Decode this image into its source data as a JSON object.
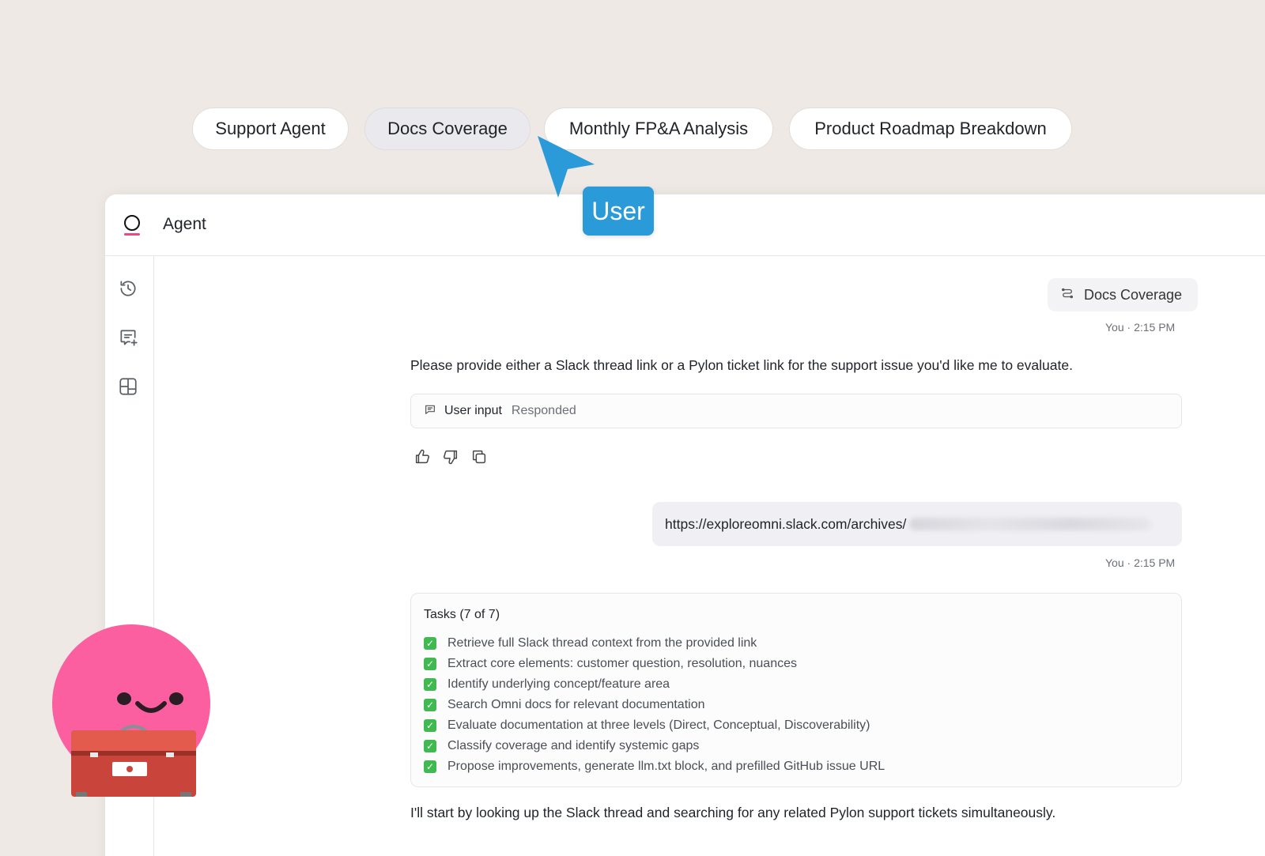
{
  "tabs": [
    {
      "label": "Support Agent",
      "active": false
    },
    {
      "label": "Docs Coverage",
      "active": true
    },
    {
      "label": "Monthly FP&A Analysis",
      "active": false
    },
    {
      "label": "Product Roadmap Breakdown",
      "active": false
    }
  ],
  "cursor_label": "User",
  "header": {
    "title": "Agent"
  },
  "sidebar": {
    "icons": [
      "history-icon",
      "new-chat-icon",
      "layout-icon"
    ]
  },
  "chat": {
    "workflow_chip": "Docs Coverage",
    "meta_1": "You · 2:15 PM",
    "agent_message_1": "Please provide either a Slack thread link or a Pylon ticket link for the support issue you'd like me to evaluate.",
    "user_input_label": "User input",
    "user_input_status": "Responded",
    "user_link": "https://exploreomni.slack.com/archives/",
    "meta_2": "You · 2:15 PM",
    "tasks_title": "Tasks (7 of 7)",
    "tasks": [
      "Retrieve full Slack thread context from the provided link",
      "Extract core elements: customer question, resolution, nuances",
      "Identify underlying concept/feature area",
      "Search Omni docs for relevant documentation",
      "Evaluate documentation at three levels (Direct, Conceptual, Discoverability)",
      "Classify coverage and identify systemic gaps",
      "Propose improvements, generate llm.txt block, and prefilled GitHub issue URL"
    ],
    "agent_message_2": "I'll start by looking up the Slack thread and searching for any related Pylon support tickets simultaneously."
  },
  "colors": {
    "cursor": "#2b9ad8",
    "accent_pink": "#fb5fa0",
    "check_green": "#3fb950"
  }
}
